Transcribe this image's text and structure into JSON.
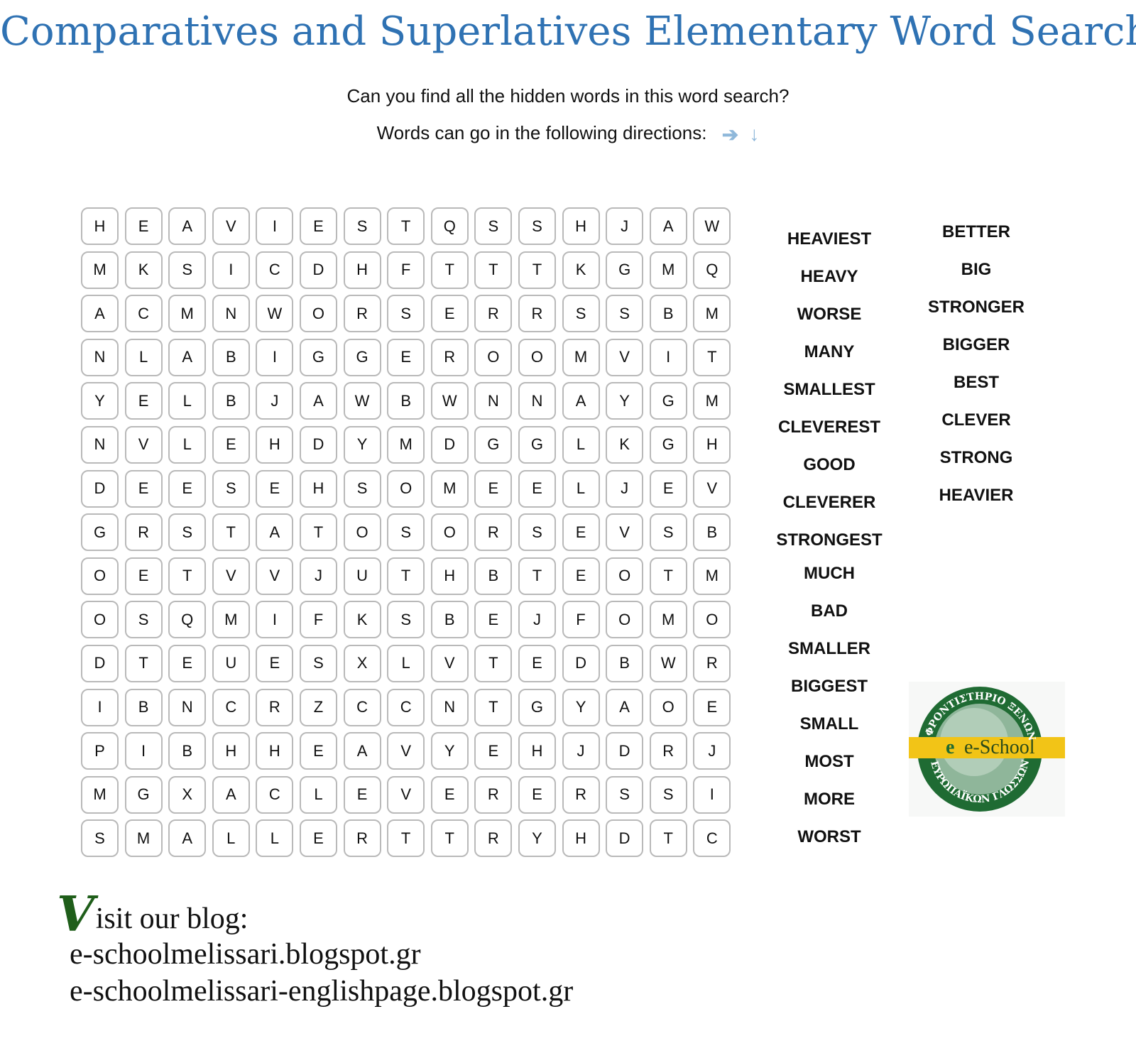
{
  "title": "Comparatives and Superlatives Elementary Word Search",
  "intro": {
    "line1": "Can you find all the hidden words in this word search?",
    "line2": "Words can go in the following directions:",
    "directions": [
      "right-arrow",
      "down-arrow"
    ],
    "arrow_color": "#8fb8da"
  },
  "grid": [
    [
      "H",
      "E",
      "A",
      "V",
      "I",
      "E",
      "S",
      "T",
      "Q",
      "S",
      "S",
      "H",
      "J",
      "A",
      "W"
    ],
    [
      "M",
      "K",
      "S",
      "I",
      "C",
      "D",
      "H",
      "F",
      "T",
      "T",
      "T",
      "K",
      "G",
      "M",
      "Q"
    ],
    [
      "A",
      "C",
      "M",
      "N",
      "W",
      "O",
      "R",
      "S",
      "E",
      "R",
      "R",
      "S",
      "S",
      "B",
      "M"
    ],
    [
      "N",
      "L",
      "A",
      "B",
      "I",
      "G",
      "G",
      "E",
      "R",
      "O",
      "O",
      "M",
      "V",
      "I",
      "T"
    ],
    [
      "Y",
      "E",
      "L",
      "B",
      "J",
      "A",
      "W",
      "B",
      "W",
      "N",
      "N",
      "A",
      "Y",
      "G",
      "M"
    ],
    [
      "N",
      "V",
      "L",
      "E",
      "H",
      "D",
      "Y",
      "M",
      "D",
      "G",
      "G",
      "L",
      "K",
      "G",
      "H"
    ],
    [
      "D",
      "E",
      "E",
      "S",
      "E",
      "H",
      "S",
      "O",
      "M",
      "E",
      "E",
      "L",
      "J",
      "E",
      "V"
    ],
    [
      "G",
      "R",
      "S",
      "T",
      "A",
      "T",
      "O",
      "S",
      "O",
      "R",
      "S",
      "E",
      "V",
      "S",
      "B"
    ],
    [
      "O",
      "E",
      "T",
      "V",
      "V",
      "J",
      "U",
      "T",
      "H",
      "B",
      "T",
      "E",
      "O",
      "T",
      "M"
    ],
    [
      "O",
      "S",
      "Q",
      "M",
      "I",
      "F",
      "K",
      "S",
      "B",
      "E",
      "J",
      "F",
      "O",
      "M",
      "O"
    ],
    [
      "D",
      "T",
      "E",
      "U",
      "E",
      "S",
      "X",
      "L",
      "V",
      "T",
      "E",
      "D",
      "B",
      "W",
      "R"
    ],
    [
      "I",
      "B",
      "N",
      "C",
      "R",
      "Z",
      "C",
      "C",
      "N",
      "T",
      "G",
      "Y",
      "A",
      "O",
      "E"
    ],
    [
      "P",
      "I",
      "B",
      "H",
      "H",
      "E",
      "A",
      "V",
      "Y",
      "E",
      "H",
      "J",
      "D",
      "R",
      "J"
    ],
    [
      "M",
      "G",
      "X",
      "A",
      "C",
      "L",
      "E",
      "V",
      "E",
      "R",
      "E",
      "R",
      "S",
      "S",
      "I"
    ],
    [
      "S",
      "M",
      "A",
      "L",
      "L",
      "E",
      "R",
      "T",
      "T",
      "R",
      "Y",
      "H",
      "D",
      "T",
      "C"
    ]
  ],
  "word_list": {
    "column1": [
      "HEAVIEST",
      "HEAVY",
      "WORSE",
      "MANY",
      "SMALLEST",
      "CLEVEREST",
      "GOOD",
      "CLEVERER",
      "STRONGEST"
    ],
    "column1b": [
      "MUCH",
      "BAD",
      "SMALLER",
      "BIGGEST",
      "SMALL",
      "MOST",
      "MORE",
      "WORST"
    ],
    "column2": [
      "BETTER",
      "BIG",
      "STRONGER",
      "BIGGER",
      "BEST",
      "CLEVER",
      "STRONG",
      "HEAVIER"
    ]
  },
  "logo": {
    "text": "e-School",
    "top_arc": "ΦΡΟΝΤΙΣΤΗΡΙΟ ΞΕΝΩΝ",
    "bottom_arc": "ΕΥΡΩΠΑΪΚΩΝ ΓΛΩΣΣΩΝ",
    "green": "#1f6b33",
    "yellow": "#f2c417"
  },
  "blog": {
    "visit_initial": "V",
    "visit_rest": "isit our blog:",
    "urls": [
      "e-schoolmelissari.blogspot.gr",
      "e-schoolmelissari-englishpage.blogspot.gr"
    ]
  }
}
